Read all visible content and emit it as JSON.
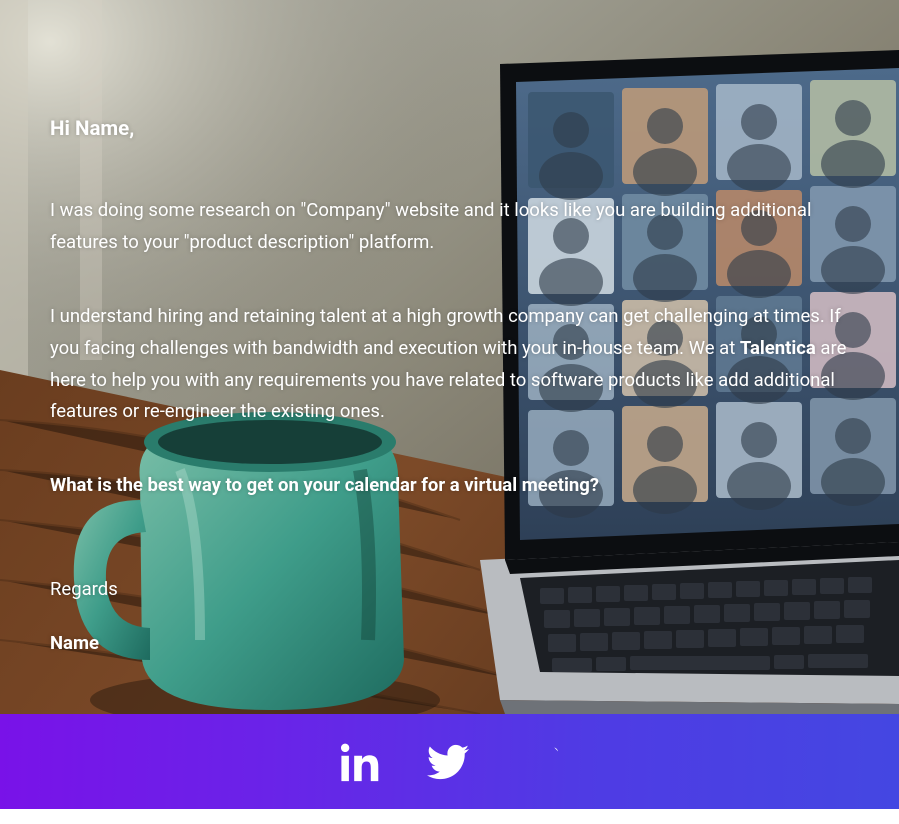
{
  "email": {
    "greeting": "Hi Name,",
    "paragraph1": "I was doing some research on \"Company\" website and it looks like you are building additional features to your \"product description\" platform.",
    "paragraph2_pre": "I understand hiring and retaining talent at a high growth company can get challenging at times. If you facing challenges with bandwidth and execution with your in-house team. We at ",
    "paragraph2_bold": "Talentica",
    "paragraph2_post": " are here to help you with any requirements you have related to software products like add additional features or re-engineer the existing ones.",
    "cta": "What is the best way to get on your calendar for a virtual meeting?",
    "regards": "Regards",
    "signature_name": "Name"
  },
  "footer": {
    "links": [
      {
        "name": "linkedin-icon"
      },
      {
        "name": "twitter-icon"
      },
      {
        "name": "youtube-icon"
      }
    ],
    "colors": {
      "grad_start": "#7912e8",
      "grad_end": "#4447e2"
    }
  }
}
